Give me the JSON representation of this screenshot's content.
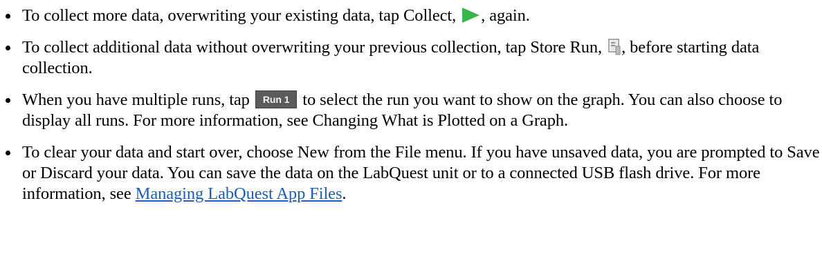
{
  "bullets": [
    {
      "pre": "To collect more data, overwriting your existing data, tap Collect, ",
      "icon": "collect-play-icon",
      "post": ", again."
    },
    {
      "pre": "To collect additional data without overwriting your previous collection, tap Store Run, ",
      "icon": "store-run-icon",
      "post": ", before starting data collection."
    },
    {
      "pre": "When you have multiple runs, tap ",
      "button_label": "Run 1",
      "post": " to select the run you want to show on the graph. You can also choose to display all runs. For more information, see Changing What is Plotted on a Graph."
    },
    {
      "text": "To clear your data and start over, choose New from the File menu. If you have unsaved data, you are prompted to Save or Discard your data. You can save the data on the LabQuest unit or to a connected USB flash drive. For more information, see ",
      "link_text": "Managing LabQuest App Files",
      "post": "."
    }
  ],
  "colors": {
    "play_green": "#39b54a",
    "link_blue": "#1a5fb4",
    "run_button_bg": "#5b5b5b"
  }
}
